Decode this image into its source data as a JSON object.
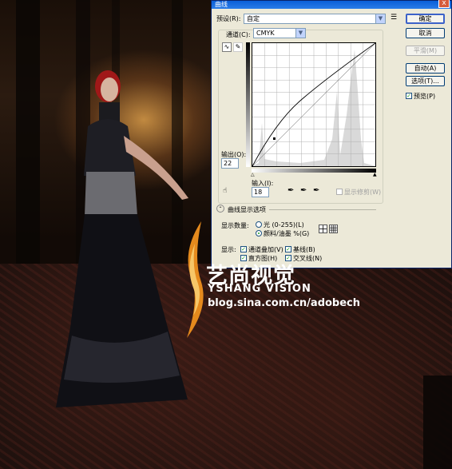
{
  "dialog": {
    "title": "曲线",
    "close_label": "x",
    "preset_label": "预设(R):",
    "preset_value": "自定",
    "preset_menu_icon": "list-menu-icon",
    "channel_label": "通道(C):",
    "channel_value": "CMYK",
    "output_label": "输出(O):",
    "output_value": "22",
    "input_label": "输入(I):",
    "input_value": "18",
    "show_clipping_label": "显示修剪(W)",
    "curve_options_label": "曲线显示选项",
    "show_amount_label": "显示数量:",
    "light_label": "光 (0-255)(L)",
    "pigment_label": "颜料/油墨 %(G)",
    "display_label": "显示:",
    "channel_overlay_label": "通道叠加(V)",
    "baseline_label": "基线(B)",
    "histogram_label": "直方图(H)",
    "intersection_label": "交叉线(N)",
    "buttons": {
      "ok": "确定",
      "cancel": "取消",
      "smooth": "平滑(M)",
      "auto": "自动(A)",
      "options": "选项(T)..."
    },
    "preview_label": "预览(P)",
    "preview_checked": true,
    "icons": {
      "curve_tool": "curve-point-icon",
      "pencil_tool": "pencil-icon",
      "on_image_adjust": "hand-adjust-icon",
      "black_eyedropper": "eyedropper-black-icon",
      "gray_eyedropper": "eyedropper-gray-icon",
      "white_eyedropper": "eyedropper-white-icon",
      "expand_toggle": "expand-chevron-icon"
    }
  },
  "watermark": {
    "chinese": "艺尚视觉",
    "english": "YSHANG VISION",
    "url": "blog.sina.com.cn/adobech"
  }
}
